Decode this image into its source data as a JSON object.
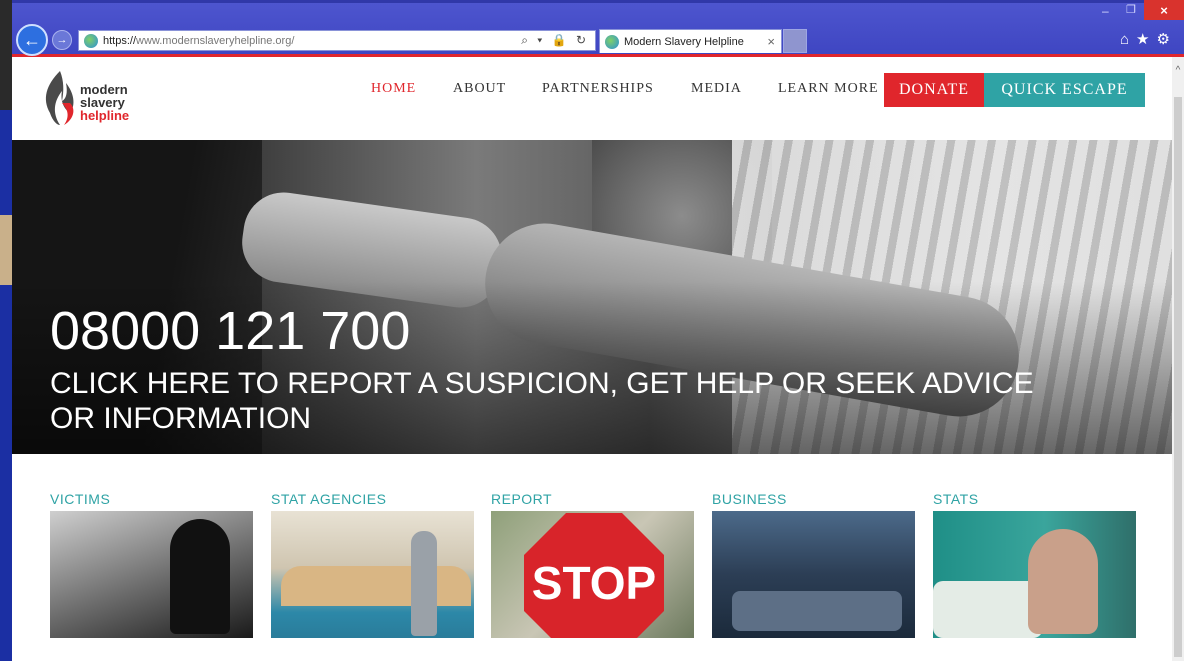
{
  "browser": {
    "url_scheme": "https://",
    "url_rest": "www.modernslaveryhelpline.org/",
    "tab_title": "Modern Slavery Helpline",
    "tab_close": "×",
    "addr_icons": "⌕ ▾ 🔒 ↻",
    "win_min": "–",
    "win_max": "❐",
    "win_close": "×",
    "tool_icons": "⌂★⚙"
  },
  "logo": {
    "line1": "modern",
    "line2": "slavery",
    "line3": "helpline"
  },
  "nav": {
    "items": [
      {
        "label": "HOME"
      },
      {
        "label": "ABOUT"
      },
      {
        "label": "PARTNERSHIPS"
      },
      {
        "label": "MEDIA"
      },
      {
        "label": "LEARN MORE"
      }
    ],
    "donate": "DONATE",
    "escape": "QUICK ESCAPE"
  },
  "hero": {
    "phone": "08000 121 700",
    "cta": "CLICK HERE TO REPORT A SUSPICION, GET HELP OR SEEK ADVICE OR INFORMATION"
  },
  "cards": [
    {
      "label": "VICTIMS"
    },
    {
      "label": "STAT AGENCIES"
    },
    {
      "label": "REPORT",
      "image_text": "STOP"
    },
    {
      "label": "BUSINESS"
    },
    {
      "label": "STATS"
    }
  ],
  "colors": {
    "accent_red": "#e0262c",
    "accent_teal": "#2fa3a5",
    "browser_frame": "#4e56cf"
  }
}
